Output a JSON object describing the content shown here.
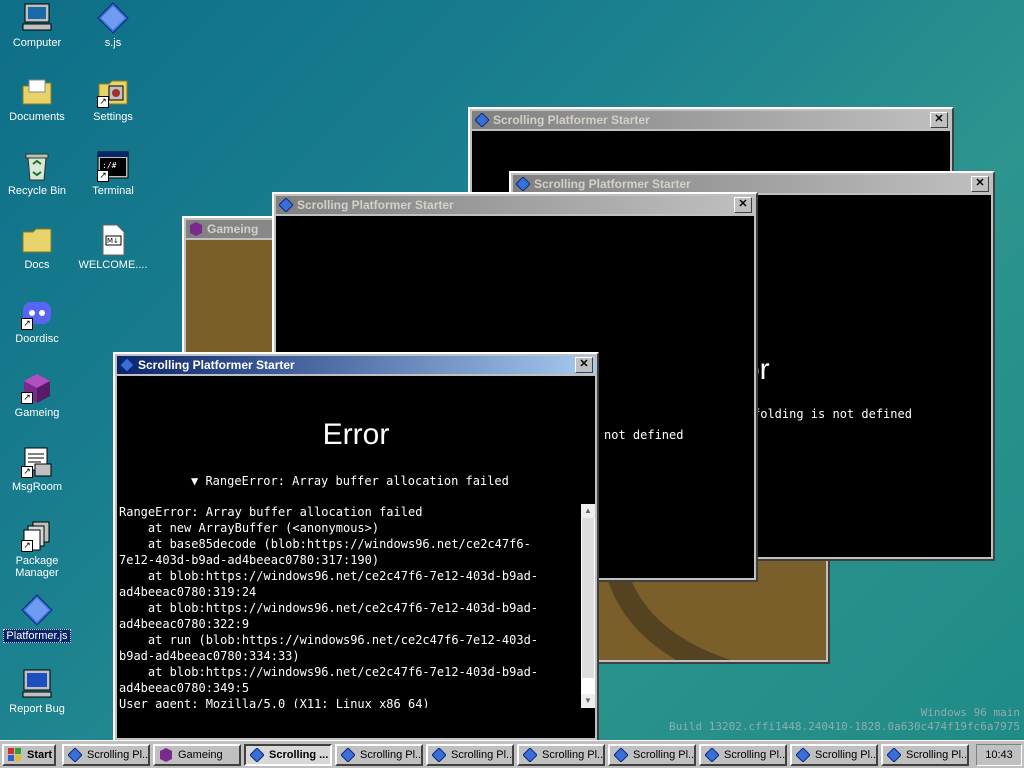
{
  "desktop": {
    "icons": [
      {
        "label": "Computer"
      },
      {
        "label": "s.js"
      },
      {
        "label": "Documents"
      },
      {
        "label": "Settings"
      },
      {
        "label": "Recycle Bin"
      },
      {
        "label": "Terminal"
      },
      {
        "label": "Docs"
      },
      {
        "label": "WELCOME...."
      },
      {
        "label": "Doordisc"
      },
      {
        "label": "Gameing"
      },
      {
        "label": "MsgRoom"
      },
      {
        "label": "Package Manager"
      },
      {
        "label": "Platformer.js"
      },
      {
        "label": "Report Bug"
      }
    ],
    "watermark_line1": "Windows 96 main",
    "watermark_line2": "Build 13202.cffi1448.240410-1828.0a630c474f19fc6a7975"
  },
  "windows": {
    "back_starter": {
      "title": "Scrolling Platformer Starter"
    },
    "right_starter": {
      "title": "Scrolling Platformer Starter",
      "error_fragment": "ror",
      "detail_fragment": "folding is not defined"
    },
    "gameing": {
      "title": "Gameing"
    },
    "middle_starter": {
      "title": "Scrolling Platformer Starter",
      "detail_fragment": "not defined"
    },
    "front_error": {
      "title": "Scrolling Platformer Starter",
      "heading": "Error",
      "summary": "▼ RangeError: Array buffer allocation failed",
      "stack_lines": [
        "RangeError: Array buffer allocation failed",
        "    at new ArrayBuffer (<anonymous>)",
        "    at base85decode (blob:https://windows96.net/ce2c47f6-",
        "7e12-403d-b9ad-ad4beeac0780:317:190)",
        "    at blob:https://windows96.net/ce2c47f6-7e12-403d-b9ad-",
        "ad4beeac0780:319:24",
        "    at blob:https://windows96.net/ce2c47f6-7e12-403d-b9ad-",
        "ad4beeac0780:322:9",
        "    at run (blob:https://windows96.net/ce2c47f6-7e12-403d-",
        "b9ad-ad4beeac0780:334:33)",
        "    at blob:https://windows96.net/ce2c47f6-7e12-403d-b9ad-",
        "ad4beeac0780:349:5",
        "User agent: Mozilla/5.0 (X11; Linux x86_64)"
      ],
      "close_label": "✕"
    }
  },
  "taskbar": {
    "start_label": "Start",
    "buttons": [
      {
        "label": "Scrolling Pl..."
      },
      {
        "label": "Gameing"
      },
      {
        "label": "Scrolling ..."
      },
      {
        "label": "Scrolling Pl..."
      },
      {
        "label": "Scrolling Pl..."
      },
      {
        "label": "Scrolling Pl..."
      },
      {
        "label": "Scrolling Pl..."
      },
      {
        "label": "Scrolling Pl..."
      },
      {
        "label": "Scrolling Pl..."
      },
      {
        "label": "Scrolling Pl..."
      }
    ],
    "clock": "10:43"
  },
  "colors": {
    "active_title": "#0a246a",
    "inactive_title": "#808080",
    "face": "#c0c0c0",
    "desktop": "#1a7f8f",
    "gameing_bg": "#7b5f2a"
  }
}
